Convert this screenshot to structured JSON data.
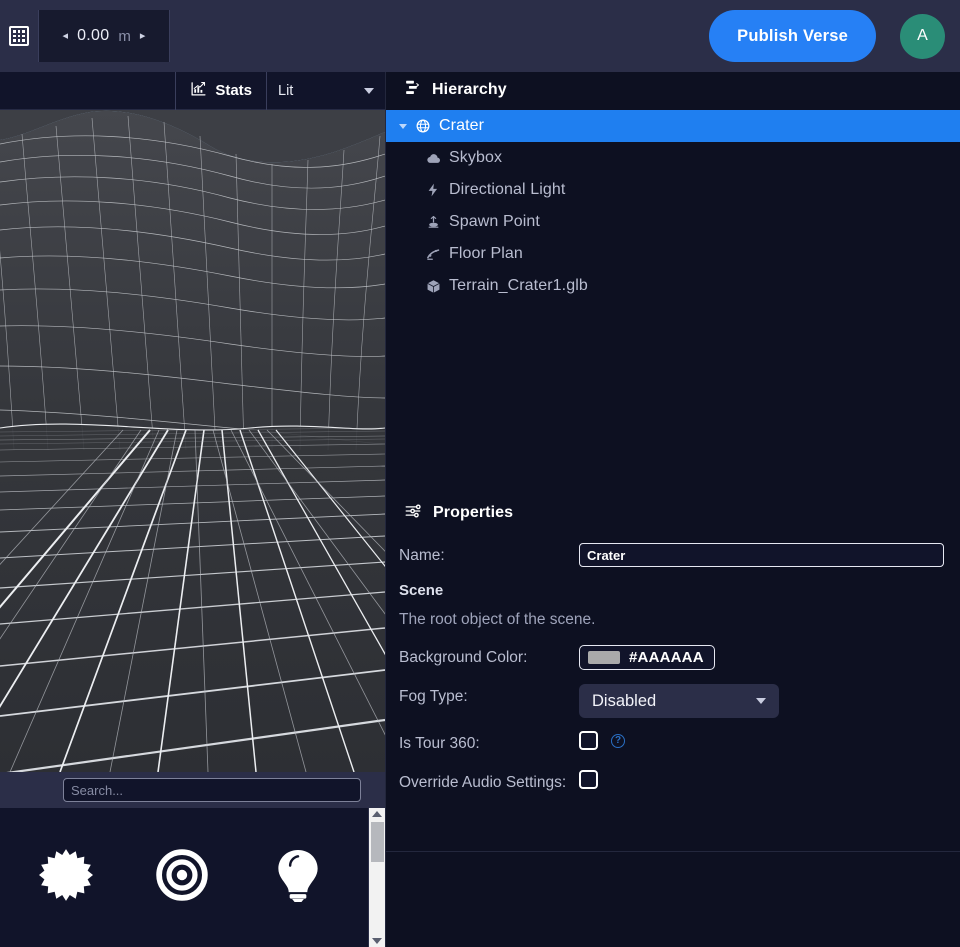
{
  "topbar": {
    "grid_icon": "grid-icon",
    "snap": {
      "prev_arrow": "◂",
      "value": "0.00",
      "unit": "m",
      "next_arrow": "▸"
    },
    "publish_label": "Publish Verse",
    "avatar_initial": "A",
    "publish_color": "#2680f5",
    "avatar_color": "#2a8d77",
    "bg_color": "#2b2e48"
  },
  "viewport_toolbar": {
    "stats_label": "Stats",
    "stats_icon": "chart-up-icon",
    "shading_mode": "Lit",
    "caret_icon": "chevron-down-icon"
  },
  "viewport": {
    "sky_color": "#8aa8c4",
    "terrain_color": "#3a3c41",
    "wireframe_color": "#ffffff"
  },
  "assets": {
    "search_placeholder": "Search...",
    "search_value": "",
    "items": [
      {
        "icon": "starburst-icon",
        "name": "starburst-asset"
      },
      {
        "icon": "bullseye-icon",
        "name": "bullseye-asset"
      },
      {
        "icon": "lightbulb-icon",
        "name": "lightbulb-asset"
      }
    ]
  },
  "hierarchy": {
    "title": "Hierarchy",
    "header_icon": "tree-icon",
    "nodes": [
      {
        "label": "Crater",
        "icon": "globe-icon",
        "depth": 0,
        "selected": true,
        "expanded": true
      },
      {
        "label": "Skybox",
        "icon": "cloud-icon",
        "depth": 1,
        "selected": false
      },
      {
        "label": "Directional Light",
        "icon": "lightning-icon",
        "depth": 1,
        "selected": false
      },
      {
        "label": "Spawn Point",
        "icon": "spawn-point-icon",
        "depth": 1,
        "selected": false
      },
      {
        "label": "Floor Plan",
        "icon": "floor-plan-icon",
        "depth": 1,
        "selected": false
      },
      {
        "label": "Terrain_Crater1.glb",
        "icon": "cube-icon",
        "depth": 1,
        "selected": false
      }
    ],
    "selection_color": "#1f7ff0"
  },
  "properties": {
    "title": "Properties",
    "header_icon": "sliders-icon",
    "name_label": "Name:",
    "name_value": "Crater",
    "section_title": "Scene",
    "section_description": "The root object of the scene.",
    "background_color_label": "Background Color:",
    "background_color_hex": "#AAAAAA",
    "fog_type_label": "Fog Type:",
    "fog_type_value": "Disabled",
    "is_tour_360_label": "Is Tour 360:",
    "is_tour_360_checked": false,
    "is_tour_360_help": "?",
    "override_audio_label": "Override Audio Settings:",
    "override_audio_checked": false
  }
}
